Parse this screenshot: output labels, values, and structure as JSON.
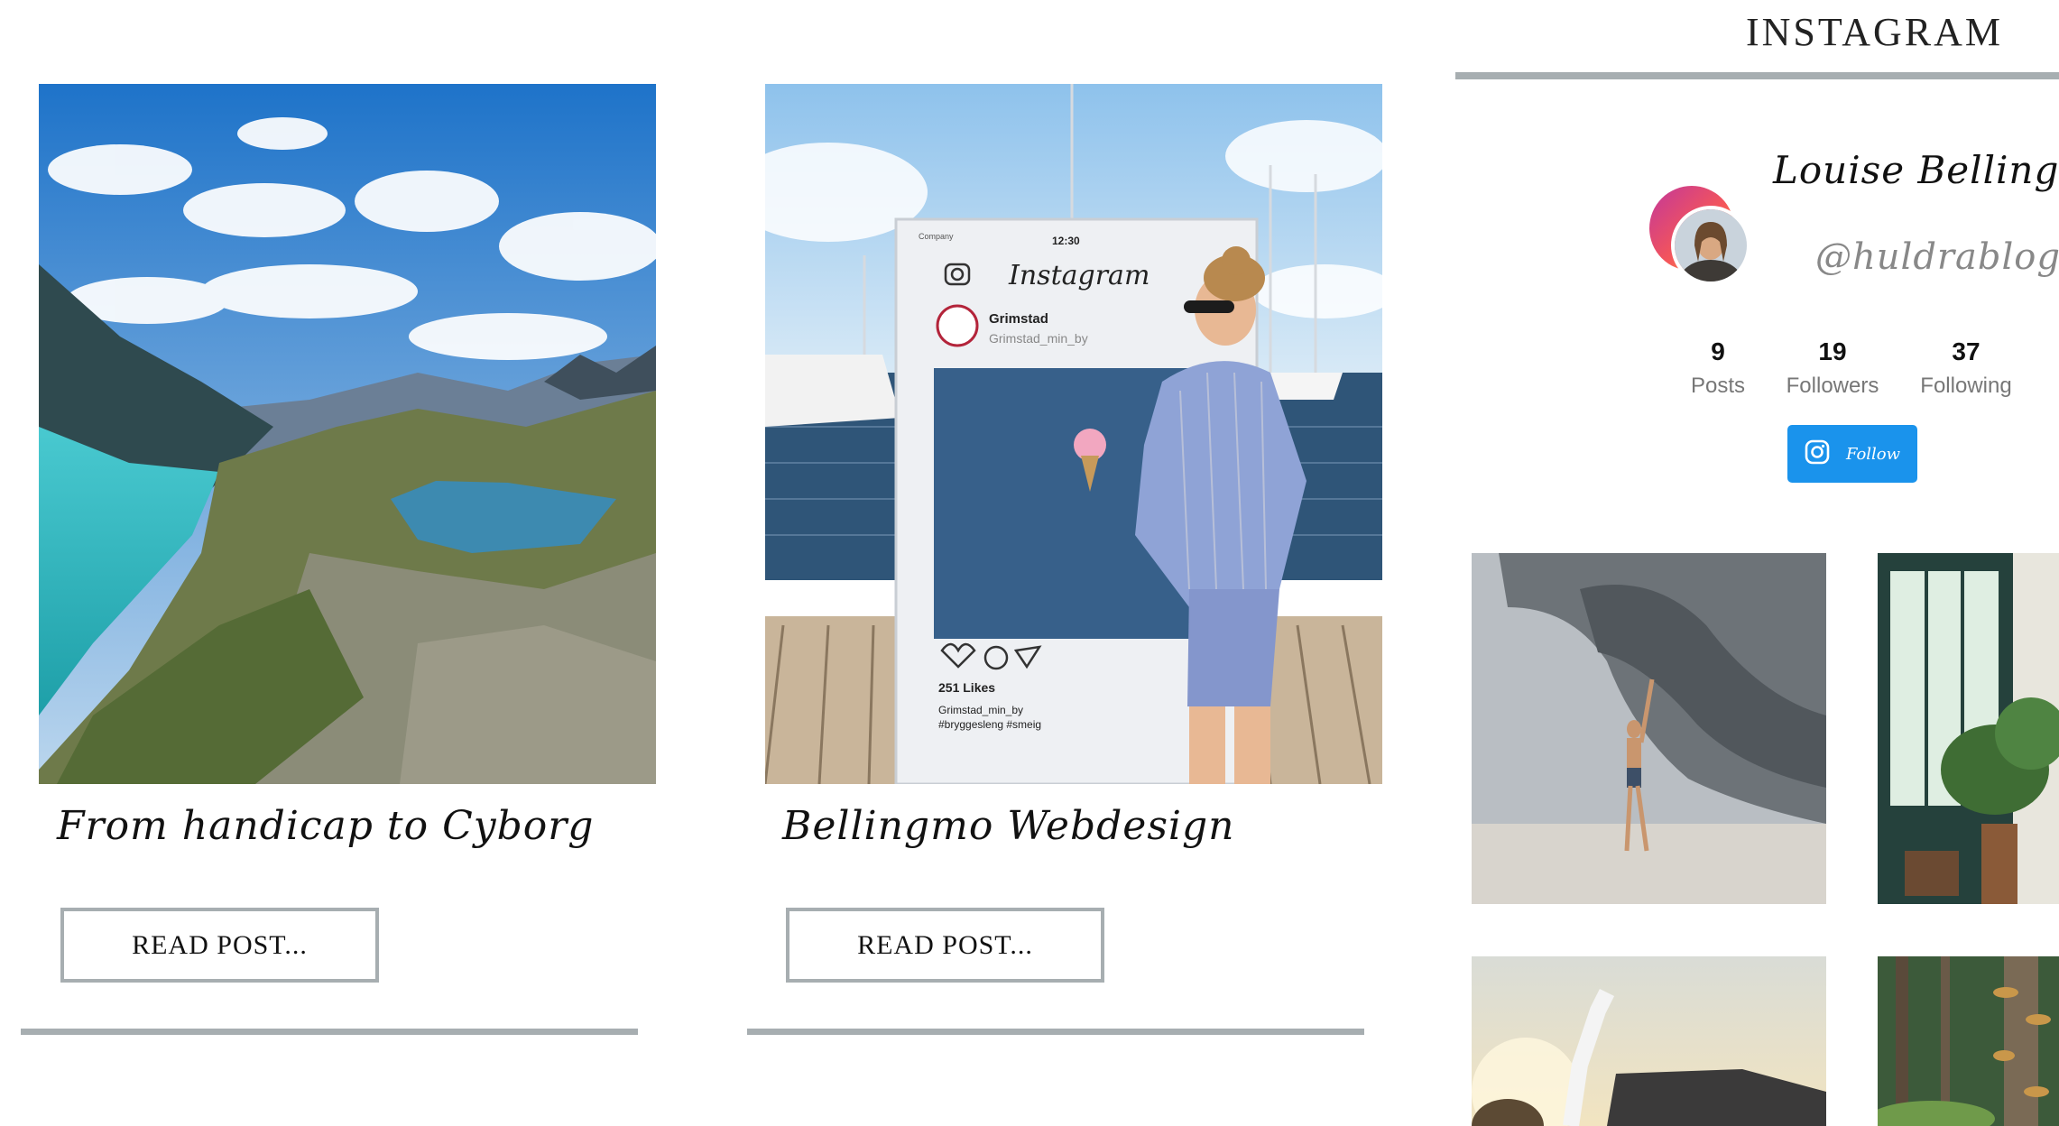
{
  "posts": [
    {
      "title": "From handicap to Cyborg",
      "button_label": "READ POST..."
    },
    {
      "title": "Bellingmo Webdesign",
      "button_label": "READ POST..."
    }
  ],
  "instagram": {
    "heading": "INSTAGRAM",
    "profile": {
      "name": "Louise Bellingmo",
      "handle": "@huldrablog"
    },
    "stats": [
      {
        "value": "9",
        "label": "Posts"
      },
      {
        "value": "19",
        "label": "Followers"
      },
      {
        "value": "37",
        "label": "Following"
      }
    ],
    "follow_label": "Follow",
    "follow_icon": "instagram-icon"
  },
  "photo_frame": {
    "status_time": "12:30",
    "carrier": "Company",
    "app_title": "Instagram",
    "account_name": "Grimstad",
    "account_handle": "Grimstad_min_by",
    "likes": "251 Likes",
    "caption_user": "Grimstad_min_by",
    "caption_tags": "#bryggesleng #smeig"
  },
  "colors": {
    "divider": "#a7aeb1",
    "follow_button": "#1a93ec",
    "avatar_ring_start": "#c2379b",
    "avatar_ring_end": "#fbb040"
  }
}
